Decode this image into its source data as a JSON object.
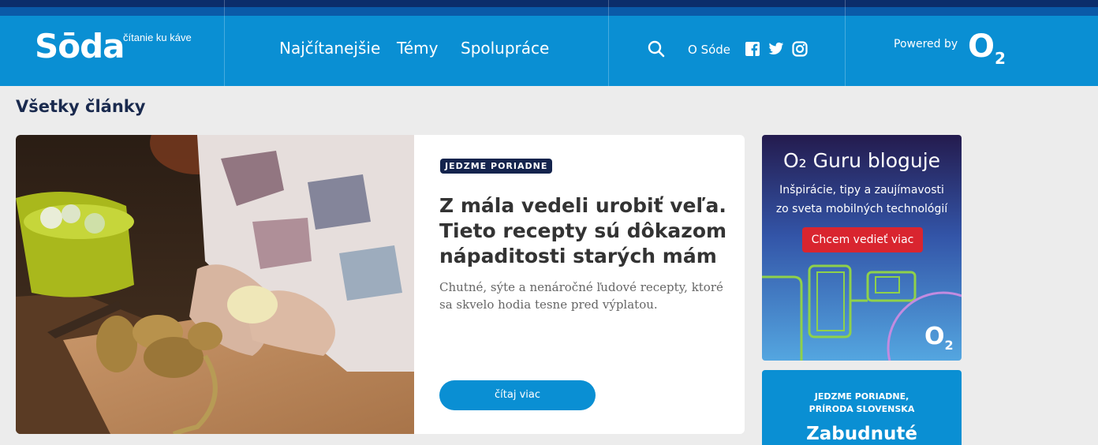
{
  "header": {
    "logo": "Sōda",
    "tagline": "čítanie ku káve",
    "nav": [
      "Najčítanejšie",
      "Témy",
      "Spolupráce"
    ],
    "about_link": "O Sóde",
    "powered_by": "Powered by",
    "brand_logo": "O",
    "brand_logo_sub": "2",
    "icons": [
      "search-icon",
      "facebook-icon",
      "twitter-icon",
      "instagram-icon"
    ]
  },
  "page_title": "Všetky články",
  "featured": {
    "category": "JEDZME PORIADNE",
    "title": "Z mála vedeli urobiť veľa. Tieto recepty sú dôkazom nápaditosti starých mám",
    "excerpt": "Chutné, sýte a nenáročné ľudové recepty, ktoré sa skvelo hodia tesne pred výplatou.",
    "button": "čítaj viac"
  },
  "ad": {
    "title": "O₂ Guru bloguje",
    "text_line1": "Inšpirácie, tipy a zaujímavosti",
    "text_line2": "zo sveta mobilných technológií",
    "button": "Chcem vedieť viac",
    "logo": "O",
    "logo_sub": "2"
  },
  "side_card": {
    "categories_line1": "JEDZME PORIADNE,",
    "categories_line2": "PRÍRODA SLOVENSKA",
    "title": "Zabudnuté"
  },
  "colors": {
    "header_blue": "#0a8fd3",
    "header_dark": "#0b2d6b",
    "badge": "#14244d",
    "ad_button": "#d9252f"
  }
}
